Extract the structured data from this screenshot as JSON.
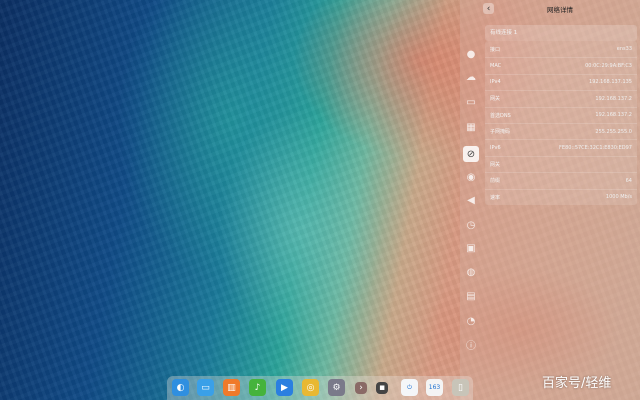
{
  "control_center": {
    "title": "网络详情",
    "back_icon": "‹",
    "connection_name": "有线连接 1",
    "sidebar_icons": [
      {
        "name": "user-icon",
        "glyph": "●"
      },
      {
        "name": "cloud-icon",
        "glyph": "☁"
      },
      {
        "name": "display-icon",
        "glyph": "▭"
      },
      {
        "name": "calendar-icon",
        "glyph": "▦"
      },
      {
        "name": "network-icon",
        "glyph": "⊘"
      },
      {
        "name": "personalization-icon",
        "glyph": "◉"
      },
      {
        "name": "sound-icon",
        "glyph": "◀"
      },
      {
        "name": "datetime-icon",
        "glyph": "◷"
      },
      {
        "name": "power-icon",
        "glyph": "▣"
      },
      {
        "name": "mouse-icon",
        "glyph": "◍"
      },
      {
        "name": "keyboard-icon",
        "glyph": "▤"
      },
      {
        "name": "update-icon",
        "glyph": "◔"
      },
      {
        "name": "info-icon",
        "glyph": "ⓘ"
      }
    ],
    "details": [
      {
        "label": "接口",
        "value": "ens33"
      },
      {
        "label": "MAC",
        "value": "00:0C:29:9A:BF:C3"
      },
      {
        "label": "IPv4",
        "value": "192.168.137.135"
      },
      {
        "label": "网关",
        "value": "192.168.137.2"
      },
      {
        "label": "首选DNS",
        "value": "192.168.137.2"
      },
      {
        "label": "子网掩码",
        "value": "255.255.255.0"
      },
      {
        "label": "IPv6",
        "value": "FE80::57CE:32C1:E830:ED97"
      },
      {
        "label": "网关",
        "value": ""
      },
      {
        "label": "前缀",
        "value": "64"
      },
      {
        "label": "速率",
        "value": "1000 Mb/s"
      }
    ]
  },
  "dock": {
    "items": [
      {
        "name": "launcher-icon",
        "glyph": "◐",
        "color": "#2f8fe0"
      },
      {
        "name": "file-manager-icon",
        "glyph": "▭",
        "color": "#3aa0e8"
      },
      {
        "name": "app-store-icon",
        "glyph": "▥",
        "color": "#f07a2a"
      },
      {
        "name": "music-icon",
        "glyph": "♪",
        "color": "#45b33c"
      },
      {
        "name": "video-icon",
        "glyph": "▶",
        "color": "#2a7fe0"
      },
      {
        "name": "chrome-icon",
        "glyph": "◎",
        "color": "#e8b832"
      },
      {
        "name": "settings-icon",
        "glyph": "⚙",
        "color": "#7a7a8a"
      },
      {
        "name": "arrow-icon",
        "glyph": "›",
        "color": "#8a6a66"
      },
      {
        "name": "terminal-icon",
        "glyph": "▪",
        "color": "#444444"
      },
      {
        "name": "shutdown-icon",
        "glyph": "⏻",
        "color": "#f4f6f8"
      },
      {
        "name": "app-163-icon",
        "glyph": "163",
        "color": "#f4f4f4"
      },
      {
        "name": "trash-icon",
        "glyph": "▯",
        "color": "#c8c4b8"
      }
    ]
  },
  "watermark": "百家号/轻维"
}
